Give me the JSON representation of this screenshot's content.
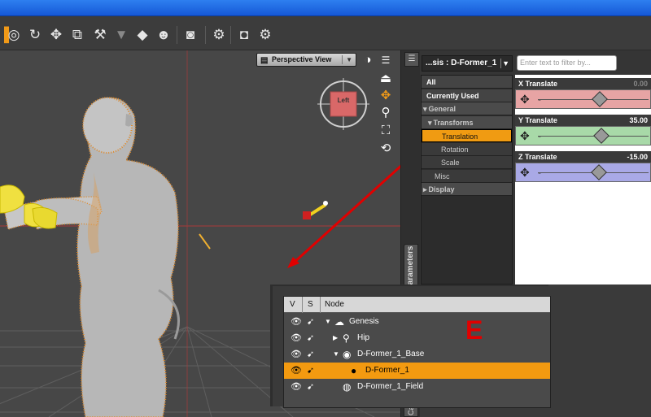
{
  "colors": {
    "accent": "#f39a10",
    "arrow": "#e00000",
    "title_blue": "#1e6ae8"
  },
  "toolbar": {
    "icons": [
      "node-selection-icon",
      "universal-tool-icon",
      "rotate-tool-icon",
      "translate-tool-icon",
      "scale-tool-icon",
      "joint-editor-icon",
      "geometry-tool-icon",
      "surface-selection-icon",
      "figure-tool-icon",
      "render-camera-icon",
      "render-settings-icon",
      "spot-render-icon",
      "camera-icon",
      "render-icon"
    ]
  },
  "viewport": {
    "view_label": "Perspective View",
    "cube_label": "Left"
  },
  "parameters": {
    "node_select": "...sis : D-Former_1",
    "filter_placeholder": "Enter text to filter by...",
    "tab_label": "Parameters",
    "tree": [
      {
        "label": "All",
        "kind": "hdr"
      },
      {
        "label": "Currently Used",
        "kind": "hdr"
      },
      {
        "label": "General",
        "kind": "grp",
        "arrow": "▾"
      },
      {
        "label": "Transforms",
        "kind": "grp",
        "arrow": "▾"
      },
      {
        "label": "Translation",
        "kind": "sel"
      },
      {
        "label": "Rotation",
        "kind": "sub"
      },
      {
        "label": "Scale",
        "kind": "sub"
      },
      {
        "label": "Misc",
        "kind": "sub"
      },
      {
        "label": "Display",
        "kind": "grp",
        "arrow": "▸"
      }
    ],
    "sliders": [
      {
        "label": "X Translate",
        "value": "0.00",
        "value_num": 0.0,
        "color": "#e7a4a4",
        "value_color": "#888"
      },
      {
        "label": "Y Translate",
        "value": "35.00",
        "value_num": 35.0,
        "color": "#a8d9a8",
        "value_color": "#fff"
      },
      {
        "label": "Z Translate",
        "value": "-15.00",
        "value_num": -15.0,
        "color": "#a9a9e6",
        "value_color": "#fff"
      }
    ]
  },
  "scene": {
    "col_v": "V",
    "col_s": "S",
    "col_node": "Node",
    "label": "E",
    "rows": [
      {
        "label": "Genesis",
        "expander": "▼",
        "icon": "figure-icon",
        "glyph": "☁",
        "depth": 0,
        "selected": false
      },
      {
        "label": "Hip",
        "expander": "▶",
        "icon": "bone-icon",
        "glyph": "⚲",
        "depth": 1,
        "selected": false
      },
      {
        "label": "D-Former_1_Base",
        "expander": "▼",
        "icon": "dformer-base-icon",
        "glyph": "◉",
        "depth": 1,
        "selected": false
      },
      {
        "label": "D-Former_1",
        "expander": "",
        "icon": "dformer-icon",
        "glyph": "●",
        "depth": 2,
        "selected": true
      },
      {
        "label": "D-Former_1_Field",
        "expander": "",
        "icon": "field-icon",
        "glyph": "◍",
        "depth": 1,
        "selected": false
      }
    ]
  },
  "side_tabs": {
    "camera_tab": "Ca"
  }
}
